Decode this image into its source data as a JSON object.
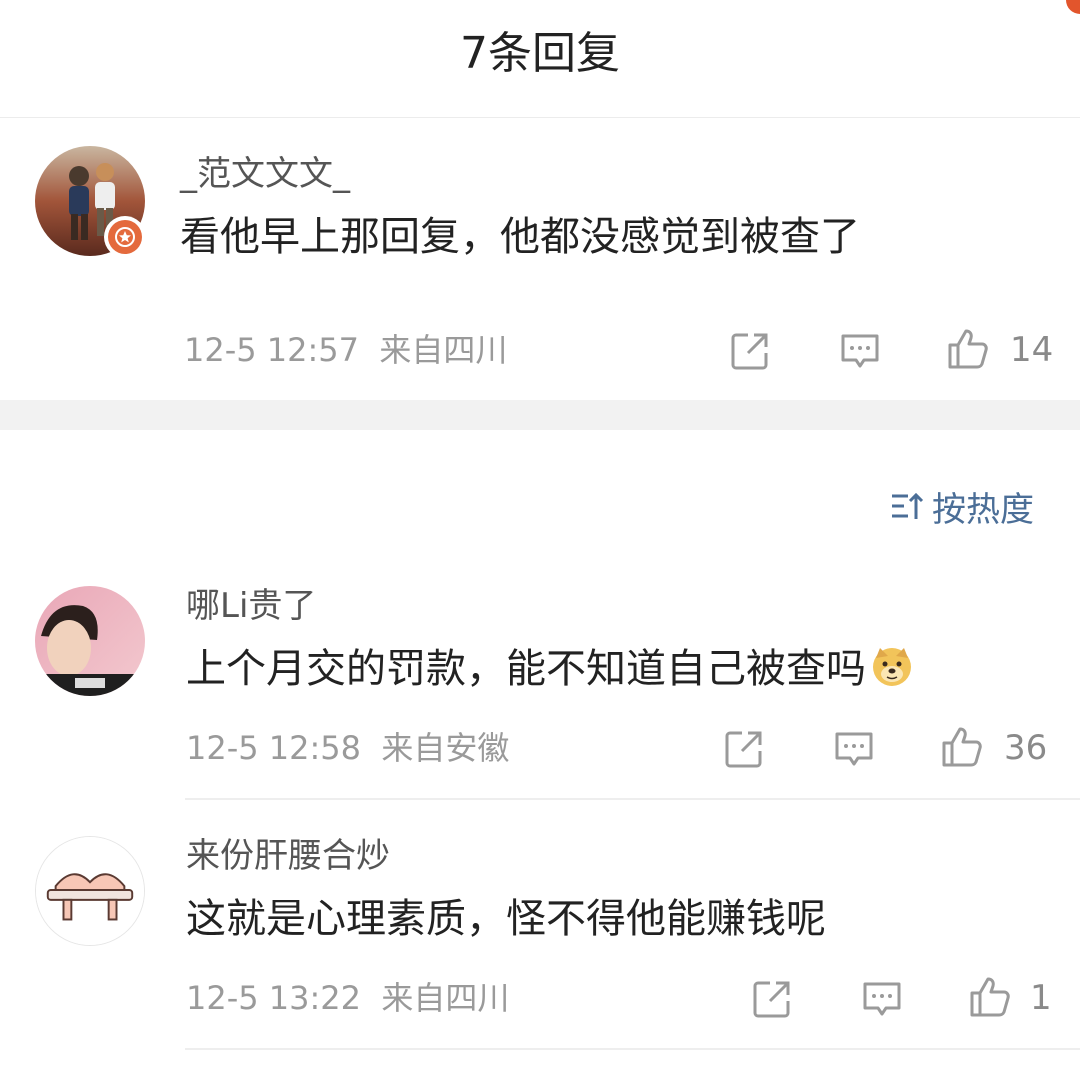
{
  "header": {
    "title": "7条回复"
  },
  "sort": {
    "label": "按热度"
  },
  "top_comment": {
    "username": "_范文文文_",
    "text": "看他早上那回复，他都没感觉到被查了",
    "time": "12-5 12:57",
    "location": "来自四川",
    "likes": "14",
    "avatar_icon": "avatar-photo-two-children",
    "badge_icon": "star-badge-icon"
  },
  "replies": [
    {
      "username": "哪Li贵了",
      "text": "上个月交的罚款，能不知道自己被查吗",
      "emoji": "doge-emoji-icon",
      "time": "12-5 12:58",
      "location": "来自安徽",
      "likes": "36"
    },
    {
      "username": "来份肝腰合炒",
      "text": "这就是心理素质，怪不得他能赚钱呢",
      "time": "12-5 13:22",
      "location": "来自四川",
      "likes": "1"
    }
  ],
  "colors": {
    "accent": "#4b6e97",
    "badge": "#e46a3d",
    "separator": "#f2f2f2",
    "meta": "#9a9a9a"
  }
}
